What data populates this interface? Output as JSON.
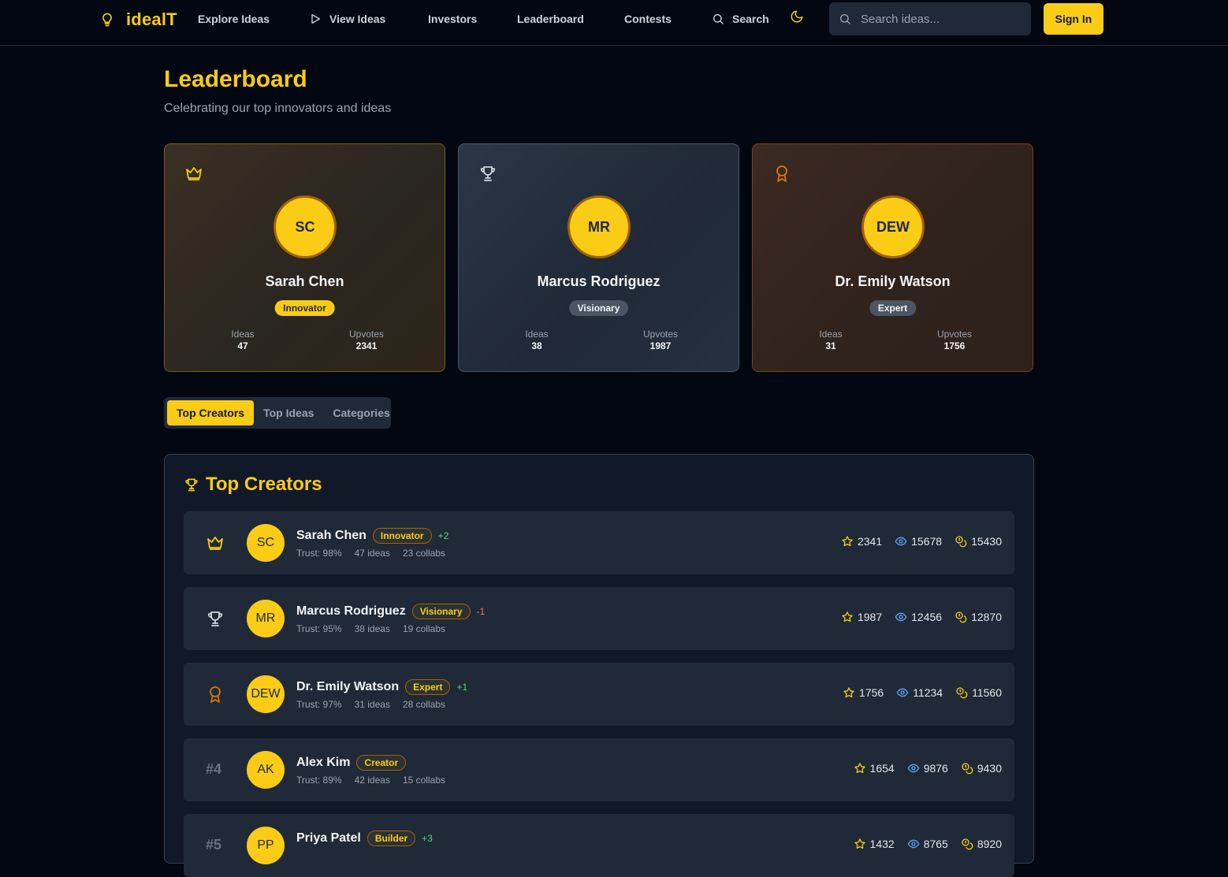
{
  "nav": {
    "logo_text": "idealT",
    "links": [
      {
        "label": "Explore Ideas"
      },
      {
        "label": "View Ideas"
      },
      {
        "label": "Investors"
      },
      {
        "label": "Leaderboard"
      },
      {
        "label": "Contests"
      },
      {
        "label": "Search"
      }
    ],
    "search_placeholder": "Search ideas...",
    "signin_label": "Sign In"
  },
  "header": {
    "title": "Leaderboard",
    "subtitle": "Celebrating our top innovators and ideas"
  },
  "podium": [
    {
      "rank_icon": "crown-icon",
      "initials": "SC",
      "name": "Sarah Chen",
      "badge": "Innovator",
      "ideas_label": "Ideas",
      "ideas": "47",
      "upvotes_label": "Upvotes",
      "upvotes": "2341"
    },
    {
      "rank_icon": "trophy-icon",
      "initials": "MR",
      "name": "Marcus Rodriguez",
      "badge": "Visionary",
      "ideas_label": "Ideas",
      "ideas": "38",
      "upvotes_label": "Upvotes",
      "upvotes": "1987"
    },
    {
      "rank_icon": "award-icon",
      "initials": "DEW",
      "name": "Dr. Emily Watson",
      "badge": "Expert",
      "ideas_label": "Ideas",
      "ideas": "31",
      "upvotes_label": "Upvotes",
      "upvotes": "1756"
    }
  ],
  "tabs": [
    {
      "label": "Top Creators",
      "active": true
    },
    {
      "label": "Top Ideas",
      "active": false
    },
    {
      "label": "Categories",
      "active": false
    }
  ],
  "list": {
    "title": "Top Creators",
    "rows": [
      {
        "rank": "",
        "rank_icon": "crown-icon",
        "initials": "SC",
        "name": "Sarah Chen",
        "badge": "Innovator",
        "change": "+2",
        "trust": "Trust: 98%",
        "ideas": "47 ideas",
        "collabs": "23 collabs",
        "stars": "2341",
        "views": "15678",
        "coins": "15430"
      },
      {
        "rank": "",
        "rank_icon": "trophy-icon",
        "initials": "MR",
        "name": "Marcus Rodriguez",
        "badge": "Visionary",
        "change": "-1",
        "trust": "Trust: 95%",
        "ideas": "38 ideas",
        "collabs": "19 collabs",
        "stars": "1987",
        "views": "12456",
        "coins": "12870"
      },
      {
        "rank": "",
        "rank_icon": "award-icon",
        "initials": "DEW",
        "name": "Dr. Emily Watson",
        "badge": "Expert",
        "change": "+1",
        "trust": "Trust: 97%",
        "ideas": "31 ideas",
        "collabs": "28 collabs",
        "stars": "1756",
        "views": "11234",
        "coins": "11560"
      },
      {
        "rank": "#4",
        "rank_icon": "",
        "initials": "AK",
        "name": "Alex Kim",
        "badge": "Creator",
        "change": "",
        "trust": "Trust: 89%",
        "ideas": "42 ideas",
        "collabs": "15 collabs",
        "stars": "1654",
        "views": "9876",
        "coins": "9430"
      },
      {
        "rank": "#5",
        "rank_icon": "",
        "initials": "PP",
        "name": "Priya Patel",
        "badge": "Builder",
        "change": "+3",
        "trust": "",
        "ideas": "",
        "collabs": "",
        "stars": "1432",
        "views": "8765",
        "coins": "8920"
      }
    ]
  },
  "colors": {
    "accent": "#facc15",
    "background": "#030712",
    "card": "#1f2937",
    "bronze": "#d97706",
    "silver": "#d1d5db",
    "up": "#4ade80",
    "down": "#f87171"
  }
}
